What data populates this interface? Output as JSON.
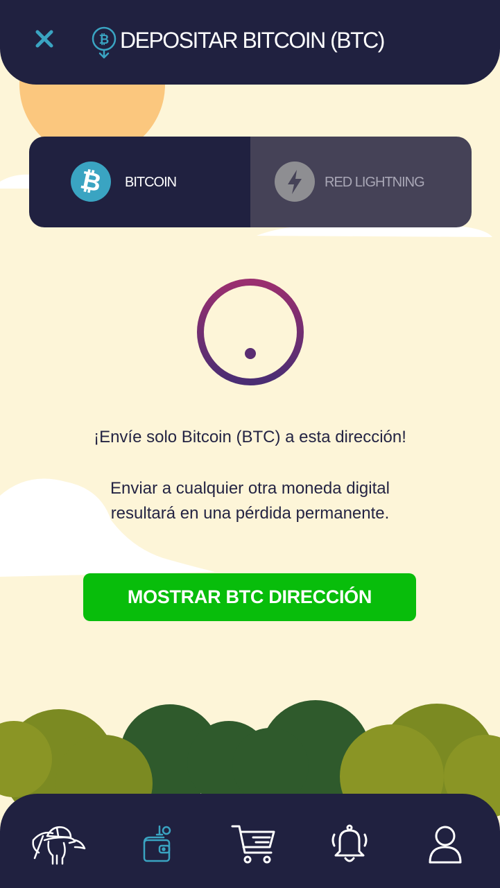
{
  "header": {
    "title": "DEPOSITAR BITCOIN (BTC)",
    "close_icon": "close-icon",
    "title_icon": "bitcoin-deposit-icon"
  },
  "tabs": [
    {
      "label": "BITCOIN",
      "icon": "bitcoin-icon",
      "active": true
    },
    {
      "label": "RED LIGHTNING",
      "icon": "lightning-icon",
      "active": false
    }
  ],
  "warning": {
    "icon": "exclamation-icon",
    "line1": "¡Envíe solo Bitcoin (BTC) a esta dirección!",
    "line2a": "Enviar a cualquier otra moneda digital",
    "line2b": "resultará en una pérdida permanente."
  },
  "cta": {
    "label": "MOSTRAR BTC DIRECCIÓN"
  },
  "bottom_nav": [
    {
      "icon": "miner-icon",
      "active": false
    },
    {
      "icon": "wallet-icon",
      "active": true
    },
    {
      "icon": "cart-icon",
      "active": false
    },
    {
      "icon": "bell-icon",
      "active": false
    },
    {
      "icon": "user-icon",
      "active": false
    }
  ],
  "colors": {
    "background": "#fdf5d8",
    "navy": "#202140",
    "accent_blue": "#3aa4c2",
    "cta_green": "#08bd0b",
    "warning_top": "#9a2f6f",
    "warning_bottom": "#4a2d73"
  }
}
